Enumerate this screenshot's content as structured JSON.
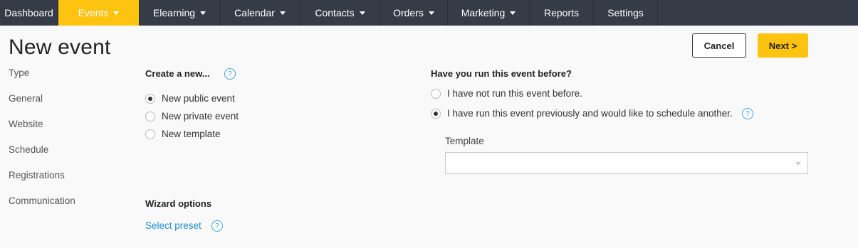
{
  "nav": {
    "items": [
      {
        "label": "Dashboard",
        "dropdown": false
      },
      {
        "label": "Events",
        "dropdown": true,
        "active": true
      },
      {
        "label": "Elearning",
        "dropdown": true
      },
      {
        "label": "Calendar",
        "dropdown": true
      },
      {
        "label": "Contacts",
        "dropdown": true
      },
      {
        "label": "Orders",
        "dropdown": true
      },
      {
        "label": "Marketing",
        "dropdown": true
      },
      {
        "label": "Reports",
        "dropdown": false
      },
      {
        "label": "Settings",
        "dropdown": false
      }
    ]
  },
  "page": {
    "title": "New event",
    "cancel_label": "Cancel",
    "next_label": "Next >"
  },
  "sidebar": {
    "items": [
      "Type",
      "General",
      "Website",
      "Schedule",
      "Registrations",
      "Communication"
    ]
  },
  "create": {
    "heading": "Create a new...",
    "help": "?",
    "options": [
      {
        "label": "New public event",
        "checked": true
      },
      {
        "label": "New private event",
        "checked": false
      },
      {
        "label": "New template",
        "checked": false
      }
    ]
  },
  "wizard": {
    "heading": "Wizard options",
    "link": "Select preset",
    "help": "?"
  },
  "history": {
    "heading": "Have you run this event before?",
    "options": [
      {
        "label": "I have not run this event before.",
        "checked": false
      },
      {
        "label": "I have run this event previously and would like to schedule another.",
        "checked": true
      }
    ],
    "help": "?",
    "template_label": "Template",
    "template_value": ""
  },
  "colors": {
    "nav_bg": "#353c48",
    "accent": "#fcc310",
    "link": "#1f8fcf"
  }
}
